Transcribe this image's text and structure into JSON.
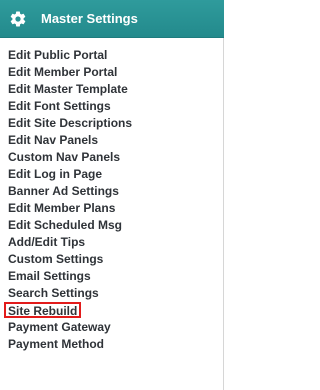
{
  "header": {
    "title": "Master Settings",
    "icon": "gear-icon"
  },
  "menu": {
    "items": [
      {
        "label": "Edit Public Portal"
      },
      {
        "label": "Edit Member Portal"
      },
      {
        "label": "Edit Master Template"
      },
      {
        "label": "Edit Font Settings"
      },
      {
        "label": "Edit Site Descriptions"
      },
      {
        "label": "Edit Nav Panels"
      },
      {
        "label": "Custom Nav Panels"
      },
      {
        "label": "Edit Log in Page"
      },
      {
        "label": "Banner Ad Settings"
      },
      {
        "label": "Edit Member Plans"
      },
      {
        "label": "Edit Scheduled Msg"
      },
      {
        "label": "Add/Edit Tips"
      },
      {
        "label": "Custom Settings"
      },
      {
        "label": "Email Settings"
      },
      {
        "label": "Search Settings"
      },
      {
        "label": "Site Rebuild",
        "highlighted": true
      },
      {
        "label": "Payment Gateway"
      },
      {
        "label": "Payment Method"
      }
    ]
  },
  "colors": {
    "header_bg": "#2f9b9c",
    "header_text": "#ffffff",
    "item_text": "#2f3338",
    "highlight_border": "#e21b1b"
  }
}
